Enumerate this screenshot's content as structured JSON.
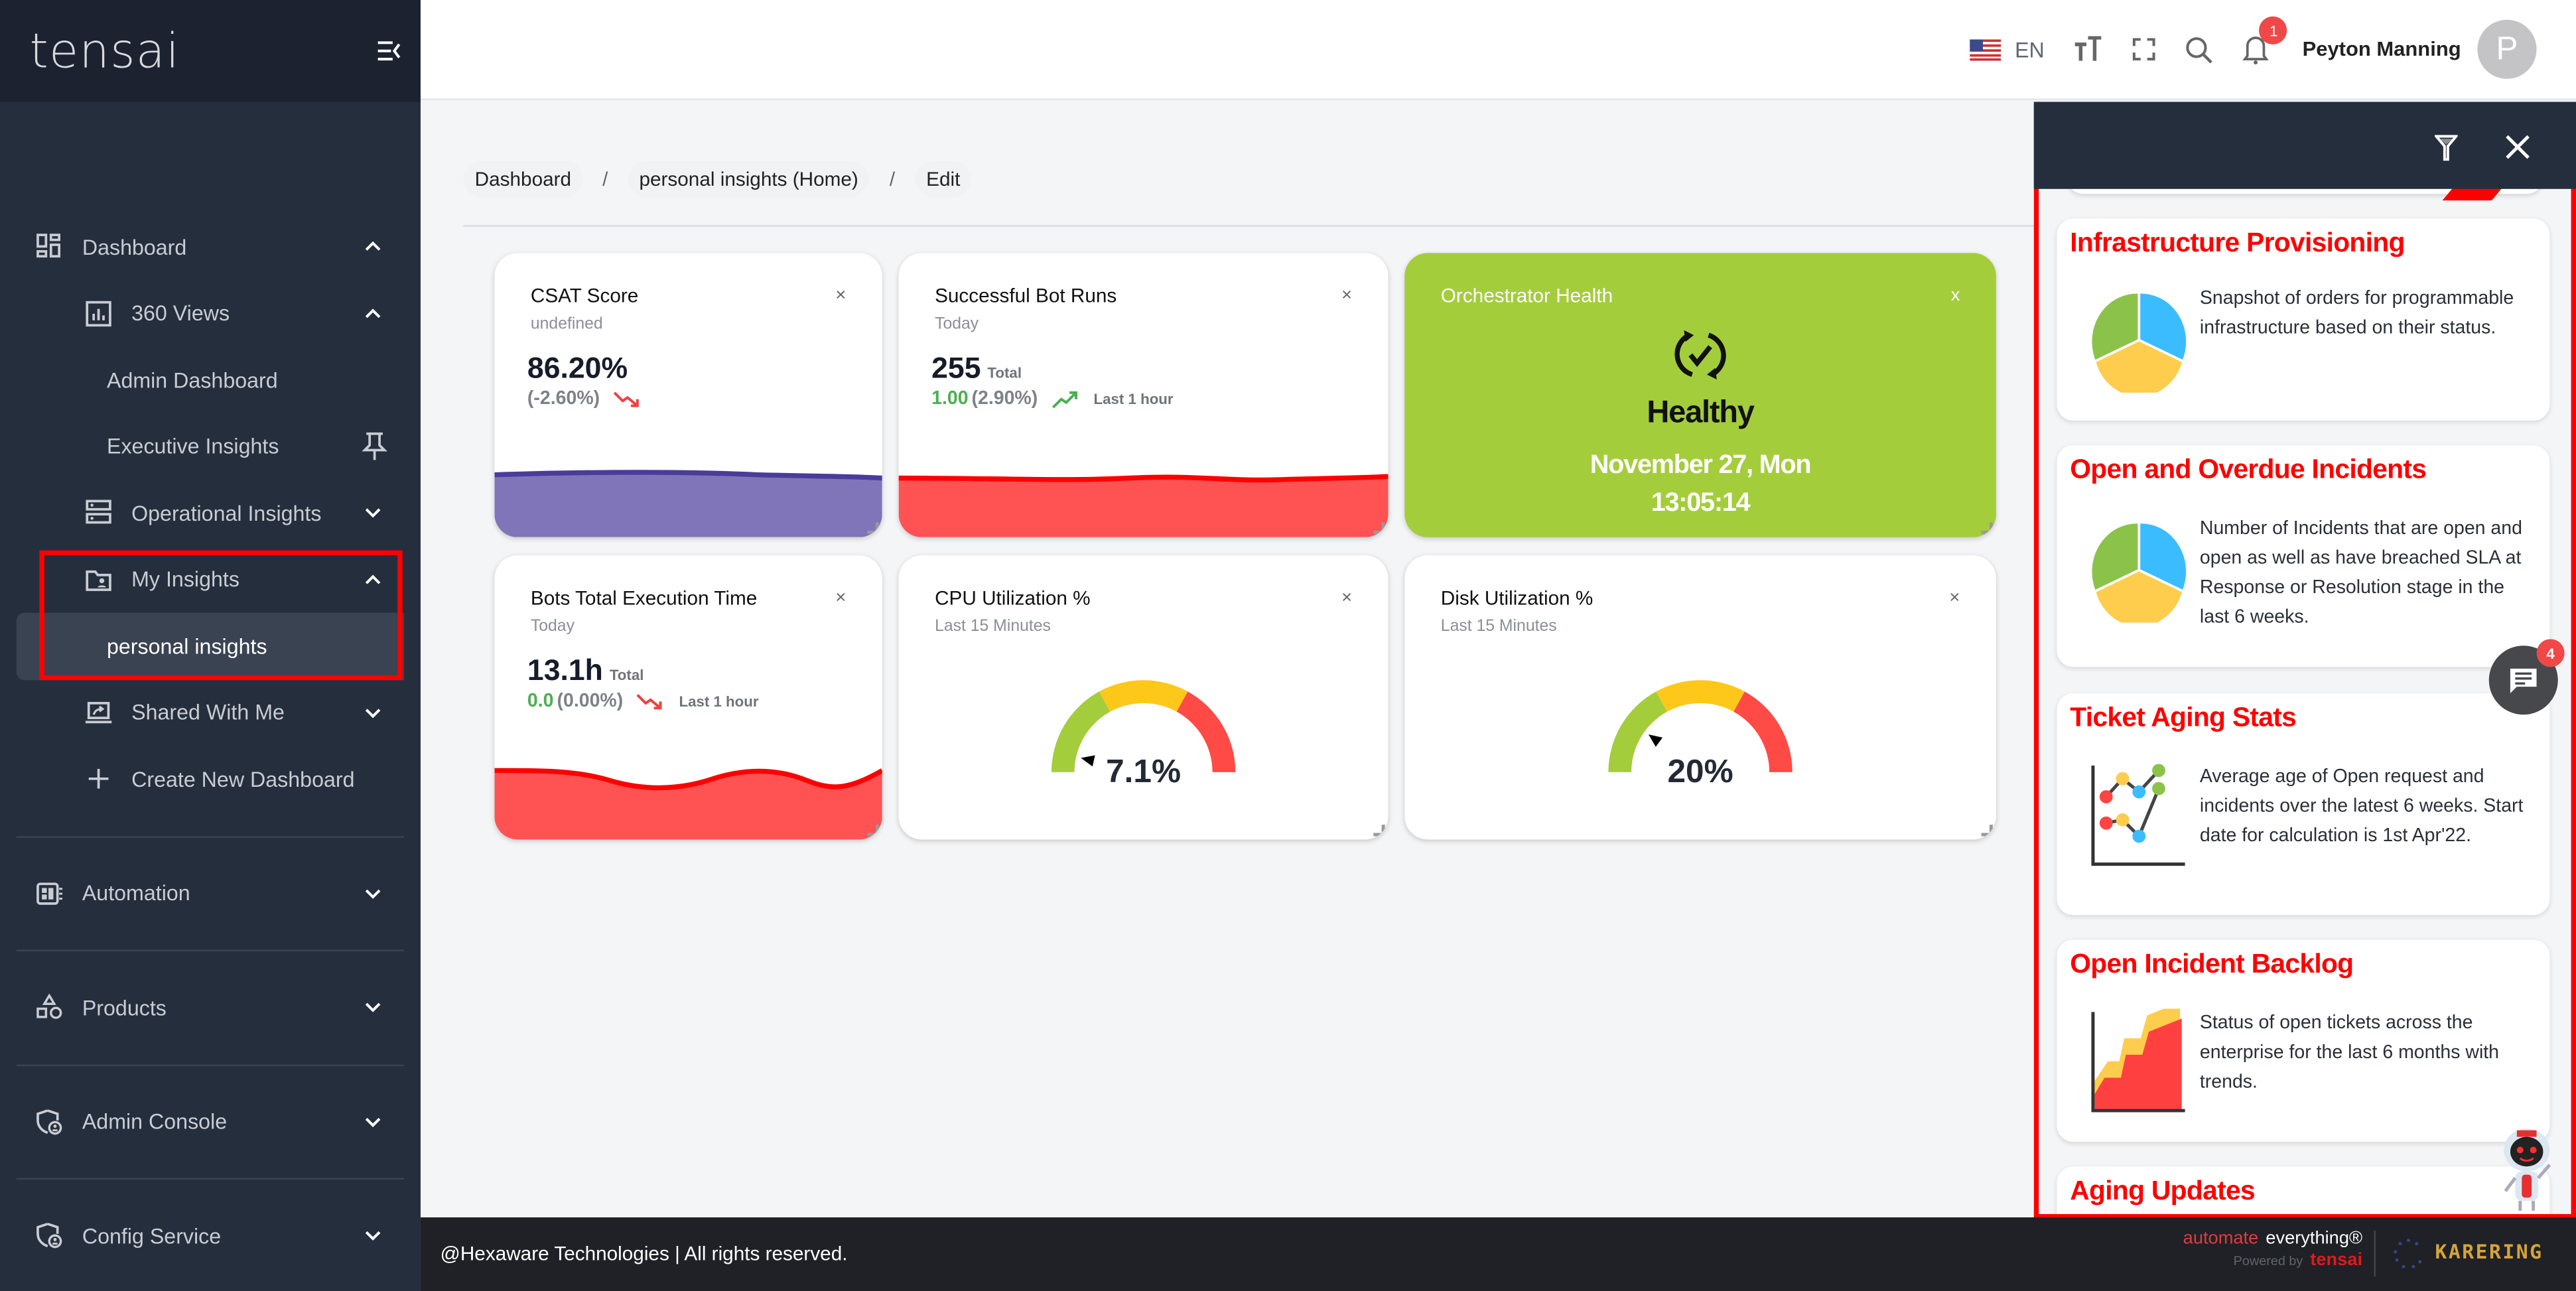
{
  "sidebar": {
    "logo": "tensai",
    "items": [
      {
        "label": "Dashboard",
        "icon": "dashboard-icon",
        "chevron": "up"
      },
      {
        "label": "360 Views",
        "icon": "bar-chart-icon",
        "chevron": "up"
      },
      {
        "label": "Admin Dashboard"
      },
      {
        "label": "Executive Insights",
        "icon": "pin-icon"
      },
      {
        "label": "Operational Insights",
        "icon": "server-icon",
        "chevron": "down"
      },
      {
        "label": "My Insights",
        "icon": "folder-user-icon",
        "chevron": "up"
      },
      {
        "label": "personal insights",
        "active": true
      },
      {
        "label": "Shared With Me",
        "icon": "screen-share-icon",
        "chevron": "down"
      },
      {
        "label": "Create New Dashboard",
        "icon": "plus-icon"
      },
      {
        "label": "Automation",
        "icon": "automation-icon",
        "chevron": "down"
      },
      {
        "label": "Products",
        "icon": "shapes-icon",
        "chevron": "down"
      },
      {
        "label": "Admin Console",
        "icon": "shield-user-icon",
        "chevron": "down"
      },
      {
        "label": "Config Service",
        "icon": "shield-user-icon",
        "chevron": "down"
      }
    ]
  },
  "topbar": {
    "language": "EN",
    "notification_count": "1",
    "user_name": "Peyton Manning",
    "avatar_initial": "P"
  },
  "breadcrumb": [
    "Dashboard",
    "personal insights (Home)",
    "Edit"
  ],
  "breadcrumb_sep": "/",
  "widgets": {
    "csat": {
      "title": "CSAT Score",
      "subtitle": "undefined",
      "value": "86.20%",
      "delta": "(-2.60%)",
      "close": "×",
      "color": "#8075b8"
    },
    "bot_runs": {
      "title": "Successful Bot Runs",
      "subtitle": "Today",
      "value": "255",
      "unit": "Total",
      "delta_value": "1.00",
      "delta_pct": "(2.90%)",
      "period": "Last 1 hour",
      "close": "×"
    },
    "orchestrator": {
      "title": "Orchestrator Health",
      "status": "Healthy",
      "date": "November 27, Mon",
      "time": "13:05:14",
      "close": "x",
      "color": "#a4cd3b"
    },
    "exec_time": {
      "title": "Bots Total Execution Time",
      "subtitle": "Today",
      "value": "13.1h",
      "unit": "Total",
      "delta_value": "0.0",
      "delta_pct": "(0.00%)",
      "period": "Last 1 hour",
      "close": "×"
    },
    "cpu": {
      "title": "CPU Utilization %",
      "subtitle": "Last 15 Minutes",
      "value": "7.1%",
      "percent": 7.1,
      "close": "×"
    },
    "disk": {
      "title": "Disk Utilization %",
      "subtitle": "Last 15 Minutes",
      "value": "20%",
      "percent": 20,
      "close": "×"
    }
  },
  "panel": {
    "cards": [
      {
        "title": "Infrastructure Provisioning",
        "description": "Snapshot of orders for programmable infrastructure based on their status.",
        "icon": "pie-chart-icon"
      },
      {
        "title": "Open and Overdue Incidents",
        "description": "Number of Incidents that are open and open as well as have breached SLA at Response or Resolution stage in the last 6 weeks.",
        "icon": "pie-chart-icon"
      },
      {
        "title": "Ticket Aging Stats",
        "description": "Average age of Open request and incidents over the latest 6 weeks. Start date for calculation is 1st Apr'22.",
        "icon": "line-chart-icon"
      },
      {
        "title": "Open Incident Backlog",
        "description": "Status of open tickets across the enterprise for the last 6 months with trends.",
        "icon": "area-chart-icon"
      },
      {
        "title": "Aging Updates"
      }
    ],
    "chat_count": "4"
  },
  "footer": {
    "copyright": "@Hexaware Technologies | All rights reserved.",
    "tagline_1": "automate",
    "tagline_2": "everything®",
    "powered_by": "Powered by",
    "powered_brand": "tensai",
    "partner": "KARERING"
  },
  "colors": {
    "accent_red": "#ff0000",
    "sidebar": "#252e3d",
    "health_green": "#a4cd3b",
    "gauge_green": "#a4cd3b",
    "gauge_yellow": "#fec81b",
    "gauge_red": "#ff4a45"
  }
}
